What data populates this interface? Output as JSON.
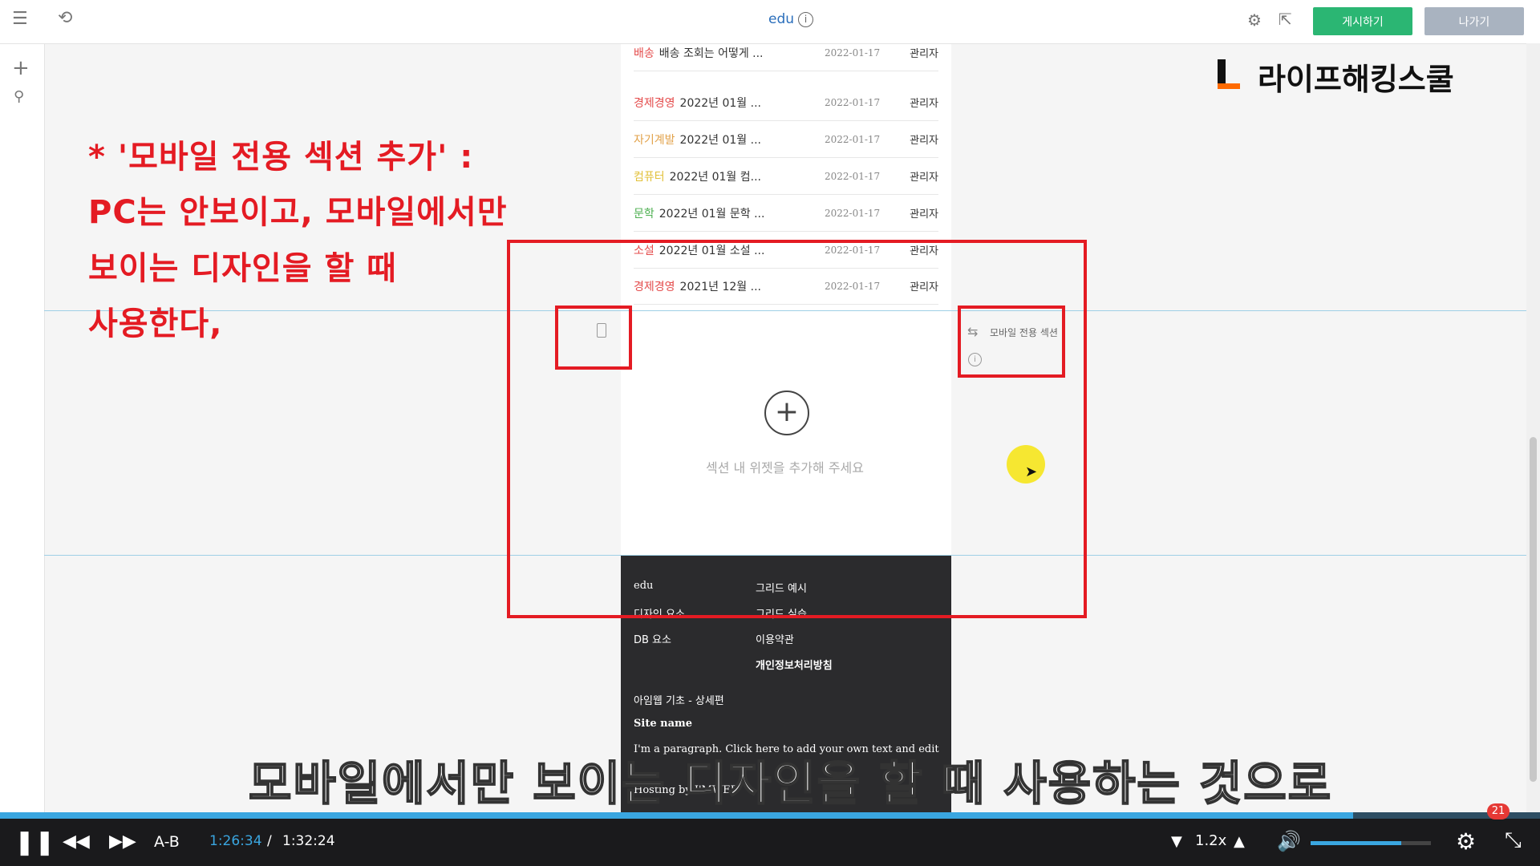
{
  "editor": {
    "site_title": "edu",
    "publish_label": "게시하기",
    "exit_label": "나가기"
  },
  "brand": {
    "logo_text": "라이프해킹스쿨"
  },
  "board_rows": [
    {
      "category": "배송",
      "category_color": "#e44b4b",
      "title": "배송 조회는 어떻게 ...",
      "date": "2022-01-17",
      "author": "관리자"
    },
    {
      "category": "경제경영",
      "category_color": "#e44b4b",
      "title": "2022년 01월 ...",
      "date": "2022-01-17",
      "author": "관리자"
    },
    {
      "category": "자기계발",
      "category_color": "#e2a24a",
      "title": "2022년 01월 ...",
      "date": "2022-01-17",
      "author": "관리자"
    },
    {
      "category": "컴퓨터",
      "category_color": "#e2c13a",
      "title": "2022년 01월 컴...",
      "date": "2022-01-17",
      "author": "관리자"
    },
    {
      "category": "문학",
      "category_color": "#4caf50",
      "title": "2022년 01월 문학 ...",
      "date": "2022-01-17",
      "author": "관리자"
    },
    {
      "category": "소설",
      "category_color": "#e44b4b",
      "title": "2022년 01월 소설 ...",
      "date": "2022-01-17",
      "author": "관리자"
    },
    {
      "category": "경제경영",
      "category_color": "#e44b4b",
      "title": "2021년 12월 ...",
      "date": "2022-01-17",
      "author": "관리자"
    }
  ],
  "section": {
    "mobile_only_label": "모바일 전용 섹션",
    "empty_hint": "섹션 내 위젯을 추가해 주세요"
  },
  "footer": {
    "col1": [
      "edu",
      "디자인 요소",
      "DB 요소"
    ],
    "col2": [
      "그리드 예시",
      "그리드 실습",
      "이용약관",
      "개인정보처리방침"
    ],
    "extra": "아임웹 기초 - 상세편",
    "site_name": "Site name",
    "paragraph": "I'm a paragraph. Click here to add your own text and edit",
    "hosting": "Hosting by I'MWEB"
  },
  "annotation": {
    "lines": [
      " * '모바일 전용 섹션 추가' :",
      "PC는 안보이고, 모바일에서만",
      "보이는 디자인을 할 때",
      "사용한다,"
    ]
  },
  "subtitle": "모바일에서만 보이는 디자인을 할 때 사용하는 것으로",
  "player": {
    "ab_label": "A-B",
    "current_time": "1:26:34",
    "separator": "/",
    "total_time": "1:32:24",
    "speed": "1.2x",
    "badge_count": "21",
    "progress_fraction": 0.937,
    "volume_fraction": 0.75
  }
}
